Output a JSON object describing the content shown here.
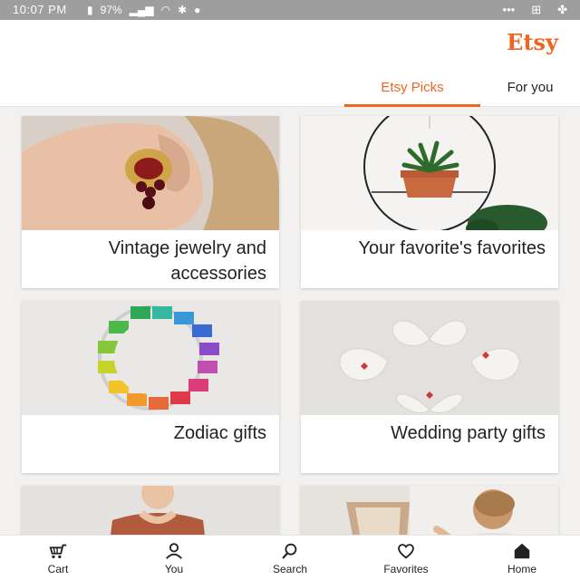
{
  "status_bar": {
    "time": "10:07 PM",
    "battery": "97%",
    "icons": [
      "signal-icon",
      "wifi-icon",
      "bluetooth-icon",
      "location-icon",
      "battery-icon",
      "more-icon",
      "grid-icon",
      "fan-icon"
    ]
  },
  "header": {
    "logo": "Etsy",
    "tabs": [
      {
        "label": "For you",
        "active": false
      },
      {
        "label": "Etsy Picks",
        "active": true
      }
    ]
  },
  "cards": [
    {
      "title": "Your favorite's favorites",
      "image": "hanging-plant"
    },
    {
      "title": "Vintage jewelry and accessories",
      "image": "earring-model"
    },
    {
      "title": "Wedding party gifts",
      "image": "heart-dishes"
    },
    {
      "title": "Zodiac gifts",
      "image": "zodiac-bracelet"
    },
    {
      "title": "",
      "image": "woman-wall-hanging"
    },
    {
      "title": "",
      "image": "woman-portrait"
    }
  ],
  "bottom_nav": [
    {
      "label": "Home",
      "icon": "home-icon"
    },
    {
      "label": "Favorites",
      "icon": "heart-icon"
    },
    {
      "label": "Search",
      "icon": "search-icon"
    },
    {
      "label": "You",
      "icon": "user-icon"
    },
    {
      "label": "Cart",
      "icon": "cart-icon"
    }
  ],
  "colors": {
    "accent": "#f1641e",
    "status_bar": "#9e9e9e",
    "background": "#f2f1ef"
  }
}
